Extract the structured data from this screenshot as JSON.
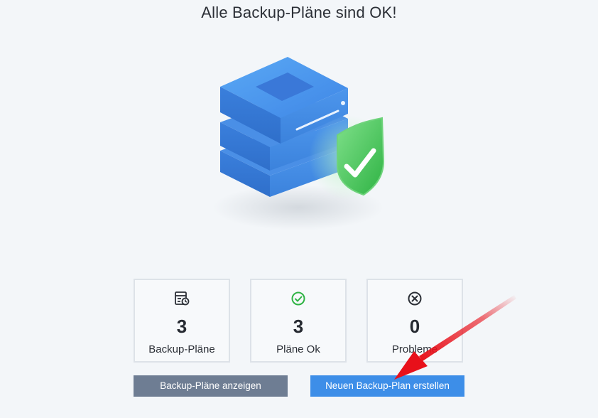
{
  "header": {
    "title": "Alle Backup-Pläne sind OK!"
  },
  "hero": {
    "illustration": "server-stack-with-check-shield",
    "colors": {
      "server": "#3f86e6",
      "shield": "#3fbf5a"
    }
  },
  "stats": [
    {
      "id": "plans",
      "icon": "backup-plan-icon",
      "value": "3",
      "label": "Backup-Pläne"
    },
    {
      "id": "ok",
      "icon": "check-circle-icon",
      "value": "3",
      "label": "Pläne Ok"
    },
    {
      "id": "problems",
      "icon": "x-circle-icon",
      "value": "0",
      "label": "Probleme"
    }
  ],
  "actions": {
    "show_plans_label": "Backup-Pläne anzeigen",
    "create_plan_label": "Neuen Backup-Plan erstellen"
  },
  "colors": {
    "background": "#f3f6f9",
    "primary_button": "#3d8ee8",
    "secondary_button": "#6e7d93",
    "ok_green": "#2fb344",
    "annotation_arrow": "#e8101a"
  }
}
